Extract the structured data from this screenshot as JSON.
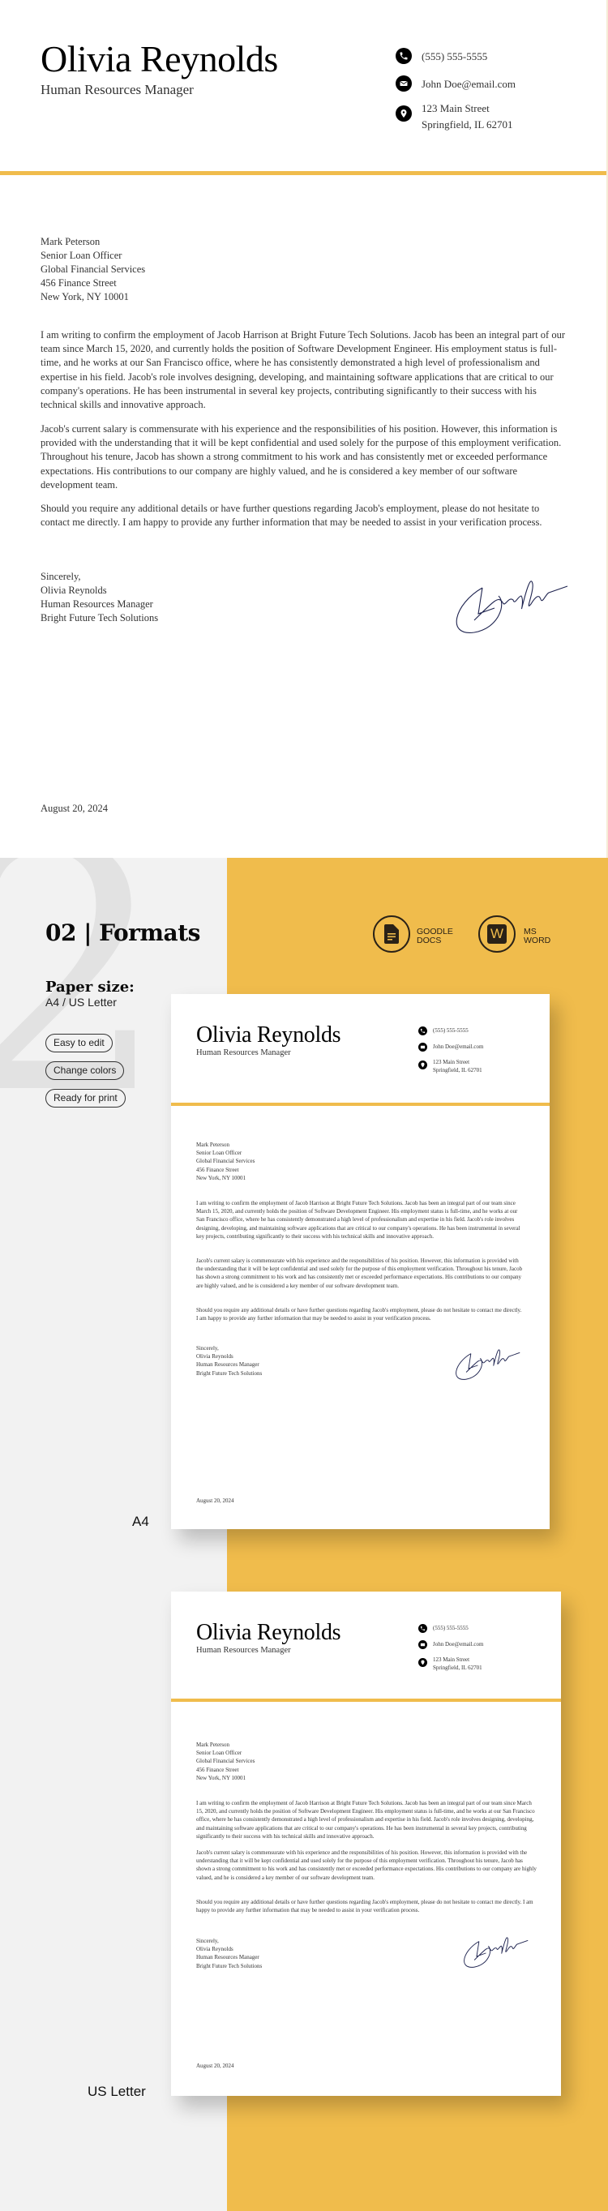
{
  "letter": {
    "sender_name": "Olivia Reynolds",
    "sender_title": "Human Resources Manager",
    "contact": {
      "phone": "(555) 555-5555",
      "email": "John Doe@email.com",
      "address_line1": "123 Main Street",
      "address_line2": "Springfield, IL 62701"
    },
    "recipient": [
      "Mark Peterson",
      "Senior Loan Officer",
      "Global Financial Services",
      "456 Finance Street",
      "New York, NY 10001"
    ],
    "paragraphs": [
      "I am writing to confirm the employment of Jacob Harrison at Bright Future Tech Solutions. Jacob has been an integral part of our team since March 15, 2020, and currently holds the position of Software Development Engineer. His employment status is full-time, and he works at our San Francisco office, where he has consistently demonstrated a high level of professionalism and expertise in his field. Jacob's role involves designing, developing, and maintaining software applications that are critical to our company's operations. He has been instrumental in several key projects, contributing significantly to their success with his technical skills and innovative approach.",
      "Jacob's current salary is commensurate with his experience and the responsibilities of his position. However, this information is provided with the understanding that it will be kept confidential and used solely for the purpose of this employment verification. Throughout his tenure, Jacob has shown a strong commitment to his work and has consistently met or exceeded performance expectations. His contributions to our company are highly valued, and he is considered a key member of our software development team.",
      "Should you require any additional details or have further questions regarding Jacob's employment, please do not hesitate to contact me directly. I am happy to provide any further information that may be needed to assist in your verification process."
    ],
    "closing": [
      "Sincerely,",
      "Olivia Reynolds",
      "Human Resources Manager",
      "Bright Future Tech Solutions"
    ],
    "date": "August 20, 2024"
  },
  "showcase": {
    "background_numeral": "2",
    "title": "02 | Formats",
    "paper_size_label": "Paper size:",
    "paper_size_value": "A4 / US Letter",
    "features": [
      "Easy to edit",
      "Change colors",
      "Ready for print"
    ],
    "formats": [
      {
        "icon": "google-docs-icon",
        "label": "GOODLE\nDOCS"
      },
      {
        "icon": "ms-word-icon",
        "label": "MS\nWORD",
        "glyph": "W"
      }
    ],
    "preview_labels": {
      "a4": "A4",
      "us_letter": "US Letter"
    }
  },
  "colors": {
    "accent": "#f0bc4c",
    "panel_gray": "#f2f2f2",
    "signature_ink": "#1f2450"
  }
}
